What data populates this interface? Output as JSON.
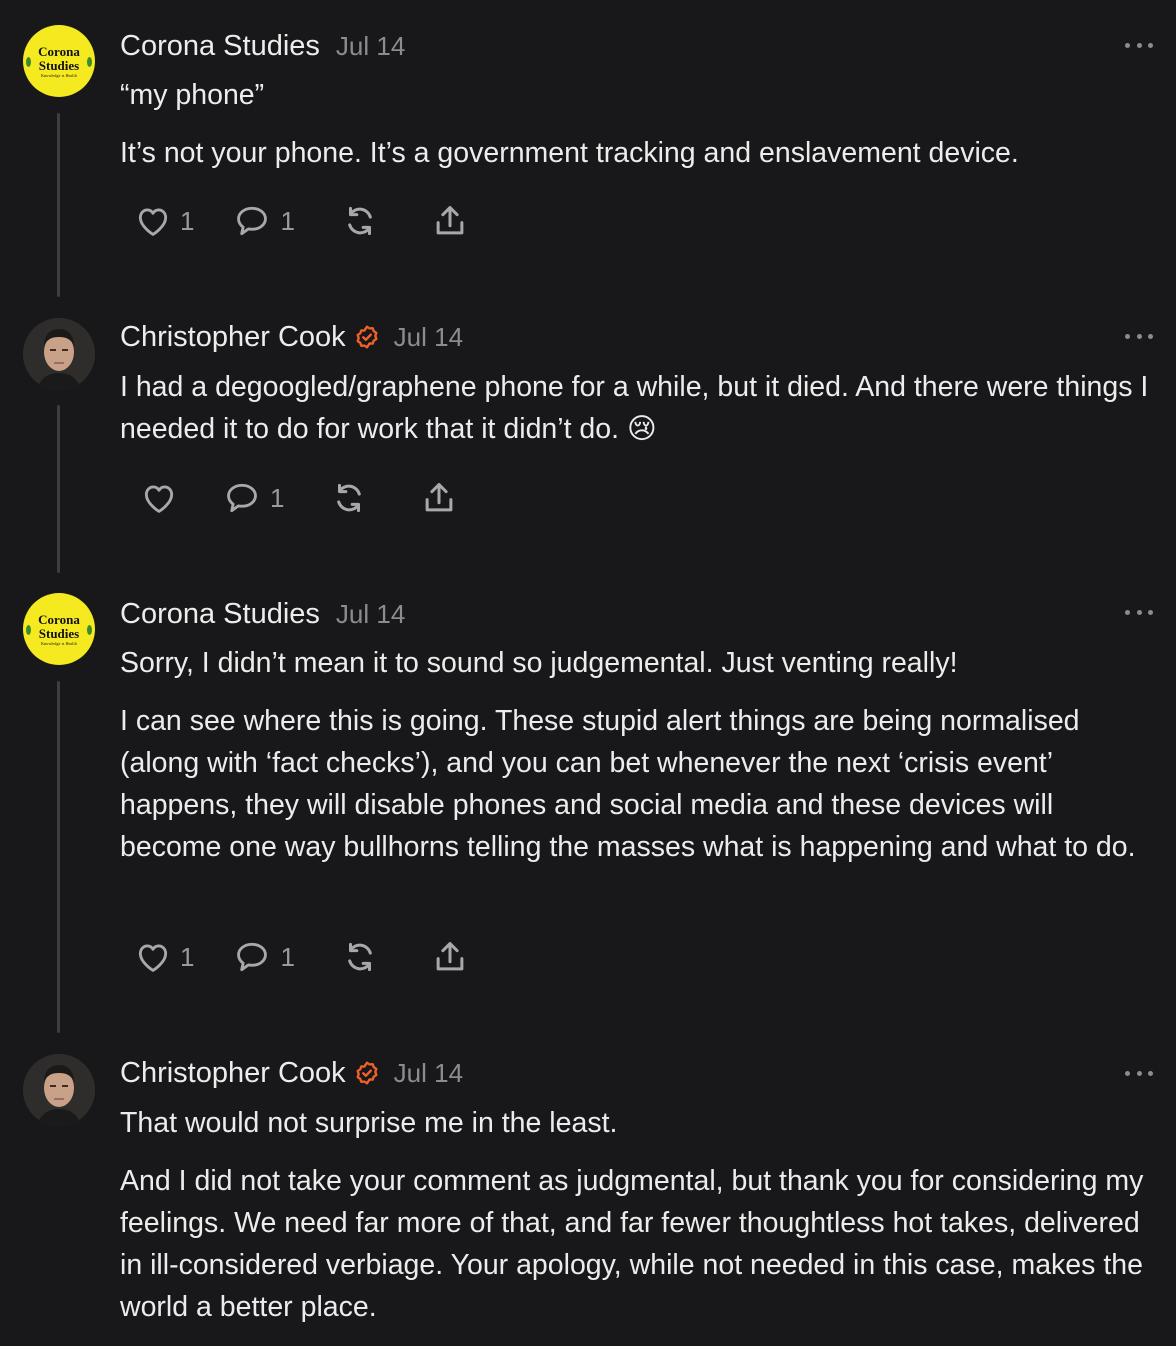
{
  "colors": {
    "background": "#18181a",
    "text": "#ececec",
    "muted": "#8c8c90",
    "verified": "#f0602a",
    "thread_line": "#3e3e42",
    "logo_bg": "#f5ea20"
  },
  "posts": [
    {
      "author": "Corona Studies",
      "avatar_logo": {
        "line1": "Corona",
        "line2": "Studies",
        "line3": "Knowledge is Health"
      },
      "verified": false,
      "date": "Jul 14",
      "paragraphs": [
        "“my phone”",
        "It’s not your phone. It’s a government tracking and enslavement device."
      ],
      "likes": "1",
      "comments": "1"
    },
    {
      "author": "Christopher Cook",
      "verified": true,
      "verified_icon": "verified-check-icon",
      "date": "Jul 14",
      "paragraphs": [
        "I had a degoogled/graphene phone for a while, but it died. And there were things I needed it to do for work that it didn’t do. 😢"
      ],
      "likes": "",
      "comments": "1"
    },
    {
      "author": "Corona Studies",
      "avatar_logo": {
        "line1": "Corona",
        "line2": "Studies",
        "line3": "Knowledge is Health"
      },
      "verified": false,
      "date": "Jul 14",
      "paragraphs": [
        "Sorry, I didn’t mean it to sound so judgemental. Just venting really!",
        "I can see where this is going. These stupid alert things are being normalised (along with ‘fact checks’), and you can bet whenever the next ‘crisis event’ happens, they will disable phones and social media and these devices will become one way bullhorns telling the masses what is happening and what to do."
      ],
      "likes": "1",
      "comments": "1"
    },
    {
      "author": "Christopher Cook",
      "verified": true,
      "verified_icon": "verified-check-icon",
      "date": "Jul 14",
      "paragraphs": [
        "That would not surprise me in the least.",
        "And I did not take your comment as judgmental, but thank you for considering my feelings. We need far more of that, and far fewer thoughtless hot takes, delivered in ill-considered verbiage. Your apology, while not needed in this case, makes the world a better place."
      ],
      "likes": "",
      "comments": ""
    }
  ],
  "icons": {
    "like": "heart-icon",
    "comment": "comment-bubble-icon",
    "restack": "restack-icon",
    "share": "share-icon",
    "more": "more-options-icon"
  }
}
